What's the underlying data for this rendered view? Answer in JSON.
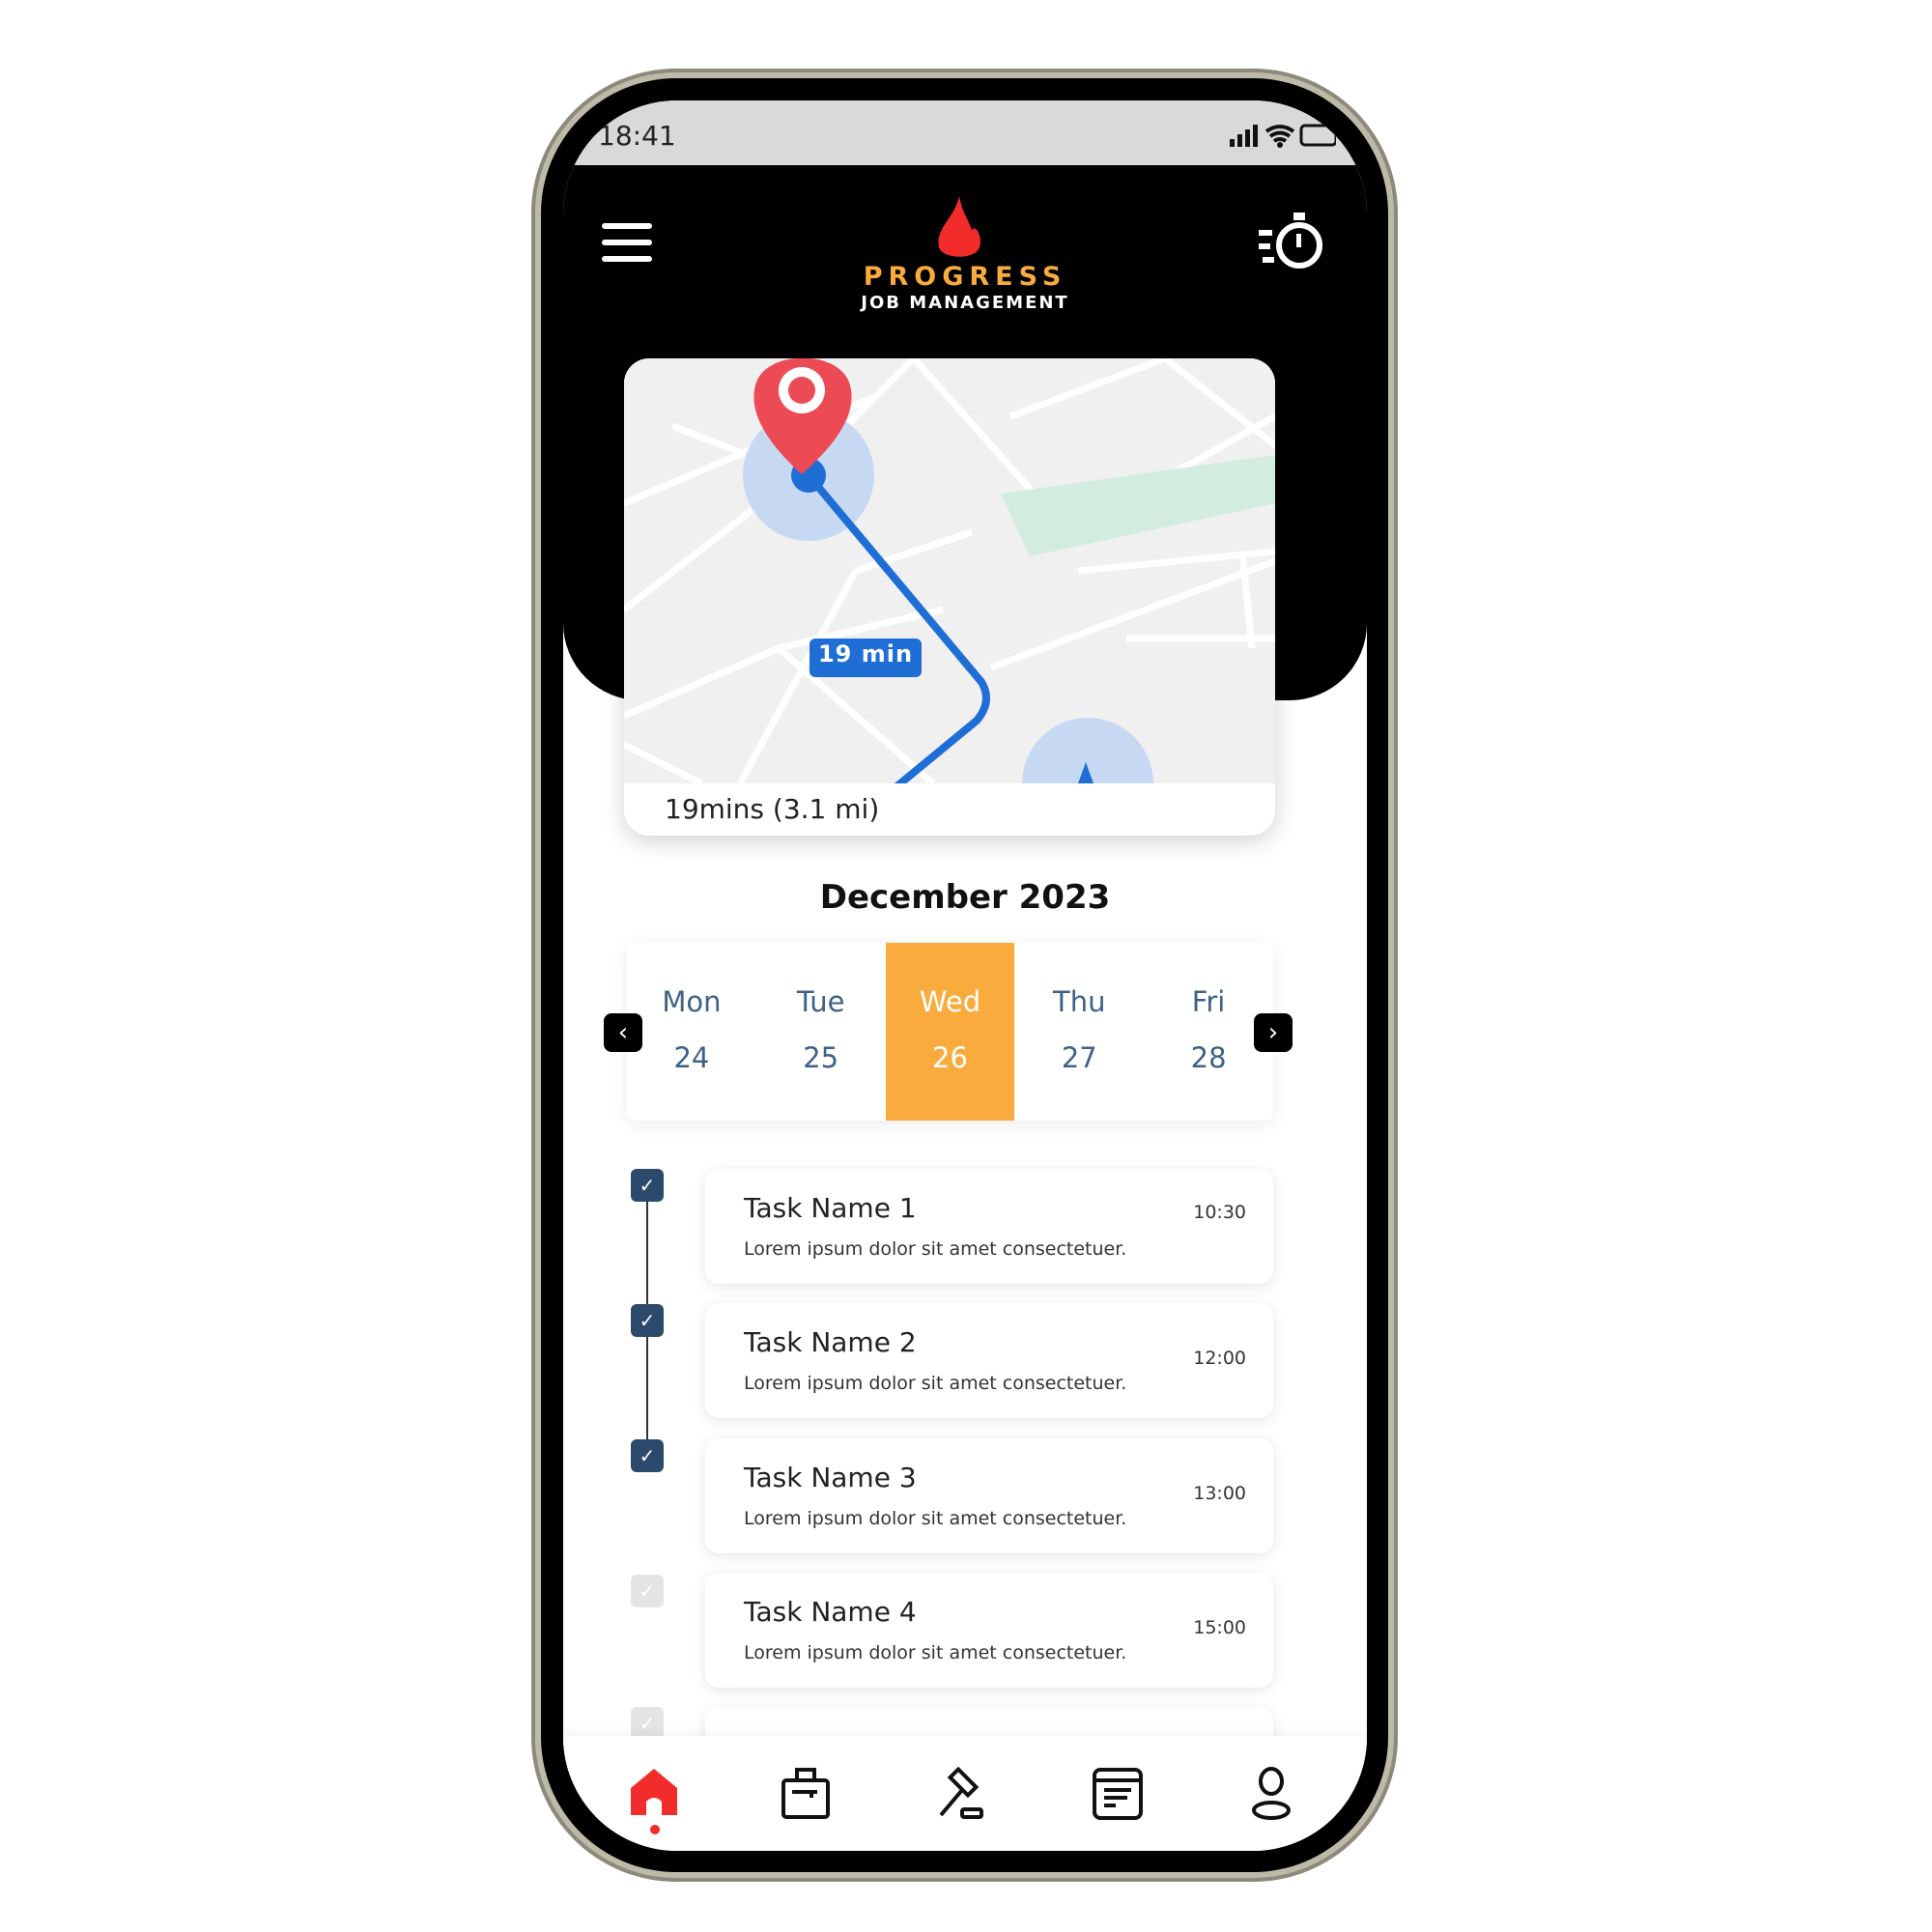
{
  "status_bar": {
    "time": "18:41"
  },
  "header": {
    "logo_line1": "PROGRESS",
    "logo_line2": "JOB MANAGEMENT",
    "menu_icon": "hamburger-icon",
    "timer_icon": "stopwatch-icon"
  },
  "map": {
    "route_label": "19 min",
    "eta": "19mins (3.1 mi)"
  },
  "calendar": {
    "month": "December 2023",
    "days": [
      {
        "name": "Mon",
        "num": "24"
      },
      {
        "name": "Tue",
        "num": "25"
      },
      {
        "name": "Wed",
        "num": "26",
        "selected": true
      },
      {
        "name": "Thu",
        "num": "27"
      },
      {
        "name": "Fri",
        "num": "28"
      }
    ],
    "selected_color": "#f9ab3d"
  },
  "tasks": [
    {
      "name": "Task Name 1",
      "desc": "Lorem ipsum dolor sit amet consectetuer.",
      "time": "10:30",
      "done": true
    },
    {
      "name": "Task Name 2",
      "desc": "Lorem ipsum dolor sit amet consectetuer.",
      "time": "12:00",
      "done": true
    },
    {
      "name": "Task Name 3",
      "desc": "Lorem ipsum dolor sit amet consectetuer.",
      "time": "13:00",
      "done": true
    },
    {
      "name": "Task Name 4",
      "desc": "Lorem ipsum dolor sit amet consectetuer.",
      "time": "15:00",
      "done": false
    }
  ],
  "nav": {
    "items": [
      "home-icon",
      "briefcase-icon",
      "gavel-icon",
      "document-icon",
      "user-icon"
    ],
    "active": "home",
    "accent": "#f22b2b"
  }
}
